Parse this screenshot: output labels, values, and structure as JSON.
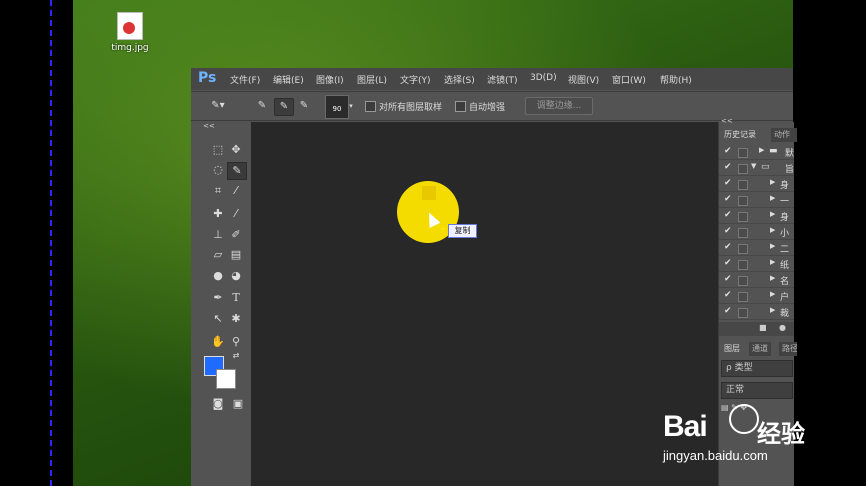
{
  "desktop": {
    "icon_label": "timg.jpg"
  },
  "menubar": {
    "logo": "Ps",
    "items": [
      "文件(F)",
      "编辑(E)",
      "图像(I)",
      "图层(L)",
      "文字(Y)",
      "选择(S)",
      "滤镜(T)",
      "3D(D)",
      "视图(V)",
      "窗口(W)",
      "帮助(H)"
    ]
  },
  "options_bar": {
    "brush_size": "90",
    "sample_all_layers_label": "对所有图层取样",
    "auto_enhance_label": "自动增强",
    "refine_edge_label": "调整边缘..."
  },
  "tools": {
    "collapse_label": "<<"
  },
  "canvas": {
    "tooltip": "复制"
  },
  "right_panel": {
    "collapse_label": "<<",
    "tabs": [
      "历史记录",
      "动作"
    ],
    "rows": [
      {
        "text": "默"
      },
      {
        "text": "旨"
      },
      {
        "text": "身"
      },
      {
        "text": "一"
      },
      {
        "text": "身"
      },
      {
        "text": "小"
      },
      {
        "text": "二"
      },
      {
        "text": "纸"
      },
      {
        "text": "名"
      },
      {
        "text": "户"
      },
      {
        "text": "裁"
      }
    ],
    "layers_tabs": [
      "图层",
      "通道",
      "路径"
    ],
    "kind_label": "ρ 类型",
    "blend_mode": "正常"
  },
  "watermark": {
    "brand_a": "Bai",
    "brand_b": "经验",
    "url": "jingyan.baidu.com"
  }
}
